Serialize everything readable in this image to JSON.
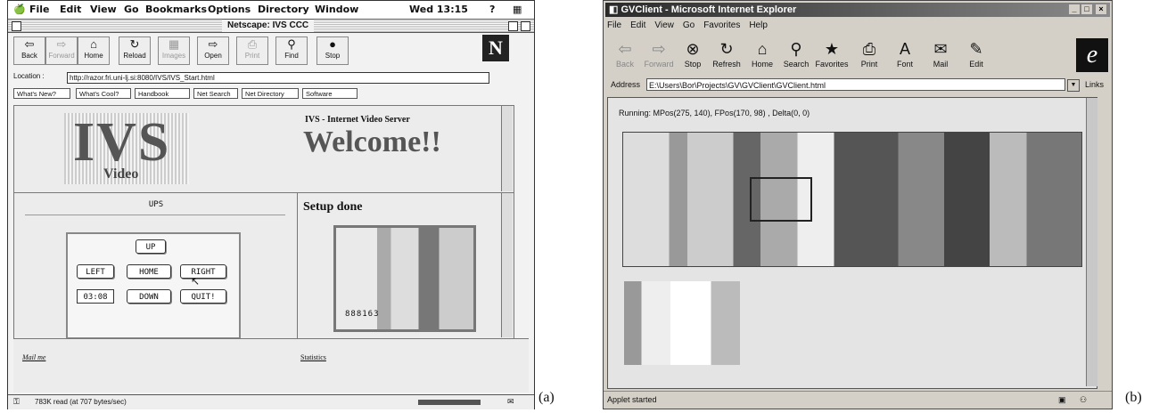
{
  "panel_a": {
    "menubar": {
      "apple": "",
      "items": [
        "File",
        "Edit",
        "View",
        "Go",
        "Bookmarks",
        "Options",
        "Directory",
        "Window"
      ],
      "clock": "Wed 13:15"
    },
    "window_title": "Netscape: IVS CCC",
    "toolbar": [
      {
        "label": "Back",
        "glyph": "⇦",
        "enabled": true
      },
      {
        "label": "Forward",
        "glyph": "⇨",
        "enabled": false
      },
      {
        "label": "Home",
        "glyph": "⌂",
        "enabled": true
      },
      {
        "label": "Reload",
        "glyph": "↻",
        "enabled": true
      },
      {
        "label": "Images",
        "glyph": "▦",
        "enabled": false
      },
      {
        "label": "Open",
        "glyph": "⇨",
        "enabled": true
      },
      {
        "label": "Print",
        "glyph": "⎙",
        "enabled": false
      },
      {
        "label": "Find",
        "glyph": "⚲",
        "enabled": true
      },
      {
        "label": "Stop",
        "glyph": "●",
        "enabled": true
      }
    ],
    "location_label": "Location :",
    "location_url": "http://razor.fri.uni-lj.si:8080/IVS/IVS_Start.html",
    "directory_buttons": [
      "What's New?",
      "What's Cool?",
      "Handbook",
      "Net Search",
      "Net Directory",
      "Software"
    ],
    "logo_text": "IVS",
    "logo_sub": "Video",
    "header_small": "IVS - Internet Video Server",
    "header_big": "Welcome!!",
    "frame_title": "UPS",
    "controls": {
      "up": "UP",
      "left": "LEFT",
      "home": "HOME",
      "right": "RIGHT",
      "time": "03:08",
      "down": "DOWN",
      "quit": "QUIT!"
    },
    "setup_text": "Setup done",
    "image_counter": "888163",
    "mail_link": "Mail me",
    "statistics_link": "Statistics",
    "status_text": "783K read (at 707 bytes/sec)",
    "caption": "(a)"
  },
  "panel_b": {
    "window_title": "GVClient - Microsoft Internet Explorer",
    "menu": [
      "File",
      "Edit",
      "View",
      "Go",
      "Favorites",
      "Help"
    ],
    "toolbar": [
      {
        "label": "Back",
        "glyph": "⇦",
        "enabled": false
      },
      {
        "label": "Forward",
        "glyph": "⇨",
        "enabled": false
      },
      {
        "label": "Stop",
        "glyph": "⊗",
        "enabled": true
      },
      {
        "label": "Refresh",
        "glyph": "↻",
        "enabled": true
      },
      {
        "label": "Home",
        "glyph": "⌂",
        "enabled": true
      },
      {
        "label": "Search",
        "glyph": "⚲",
        "enabled": true
      },
      {
        "label": "Favorites",
        "glyph": "★",
        "enabled": true
      },
      {
        "label": "Print",
        "glyph": "⎙",
        "enabled": true
      },
      {
        "label": "Font",
        "glyph": "A",
        "enabled": true
      },
      {
        "label": "Mail",
        "glyph": "✉",
        "enabled": true
      },
      {
        "label": "Edit",
        "glyph": "✎",
        "enabled": true
      }
    ],
    "address_label": "Address",
    "address_value": "E:\\Users\\Bor\\Projects\\GV\\GVClient\\GVClient.html",
    "links_label": "Links",
    "running_text": "Running: MPos(275, 140),  FPos(170, 98) ,  Delta(0, 0)",
    "status_text": "Applet started",
    "caption": "(b)"
  }
}
